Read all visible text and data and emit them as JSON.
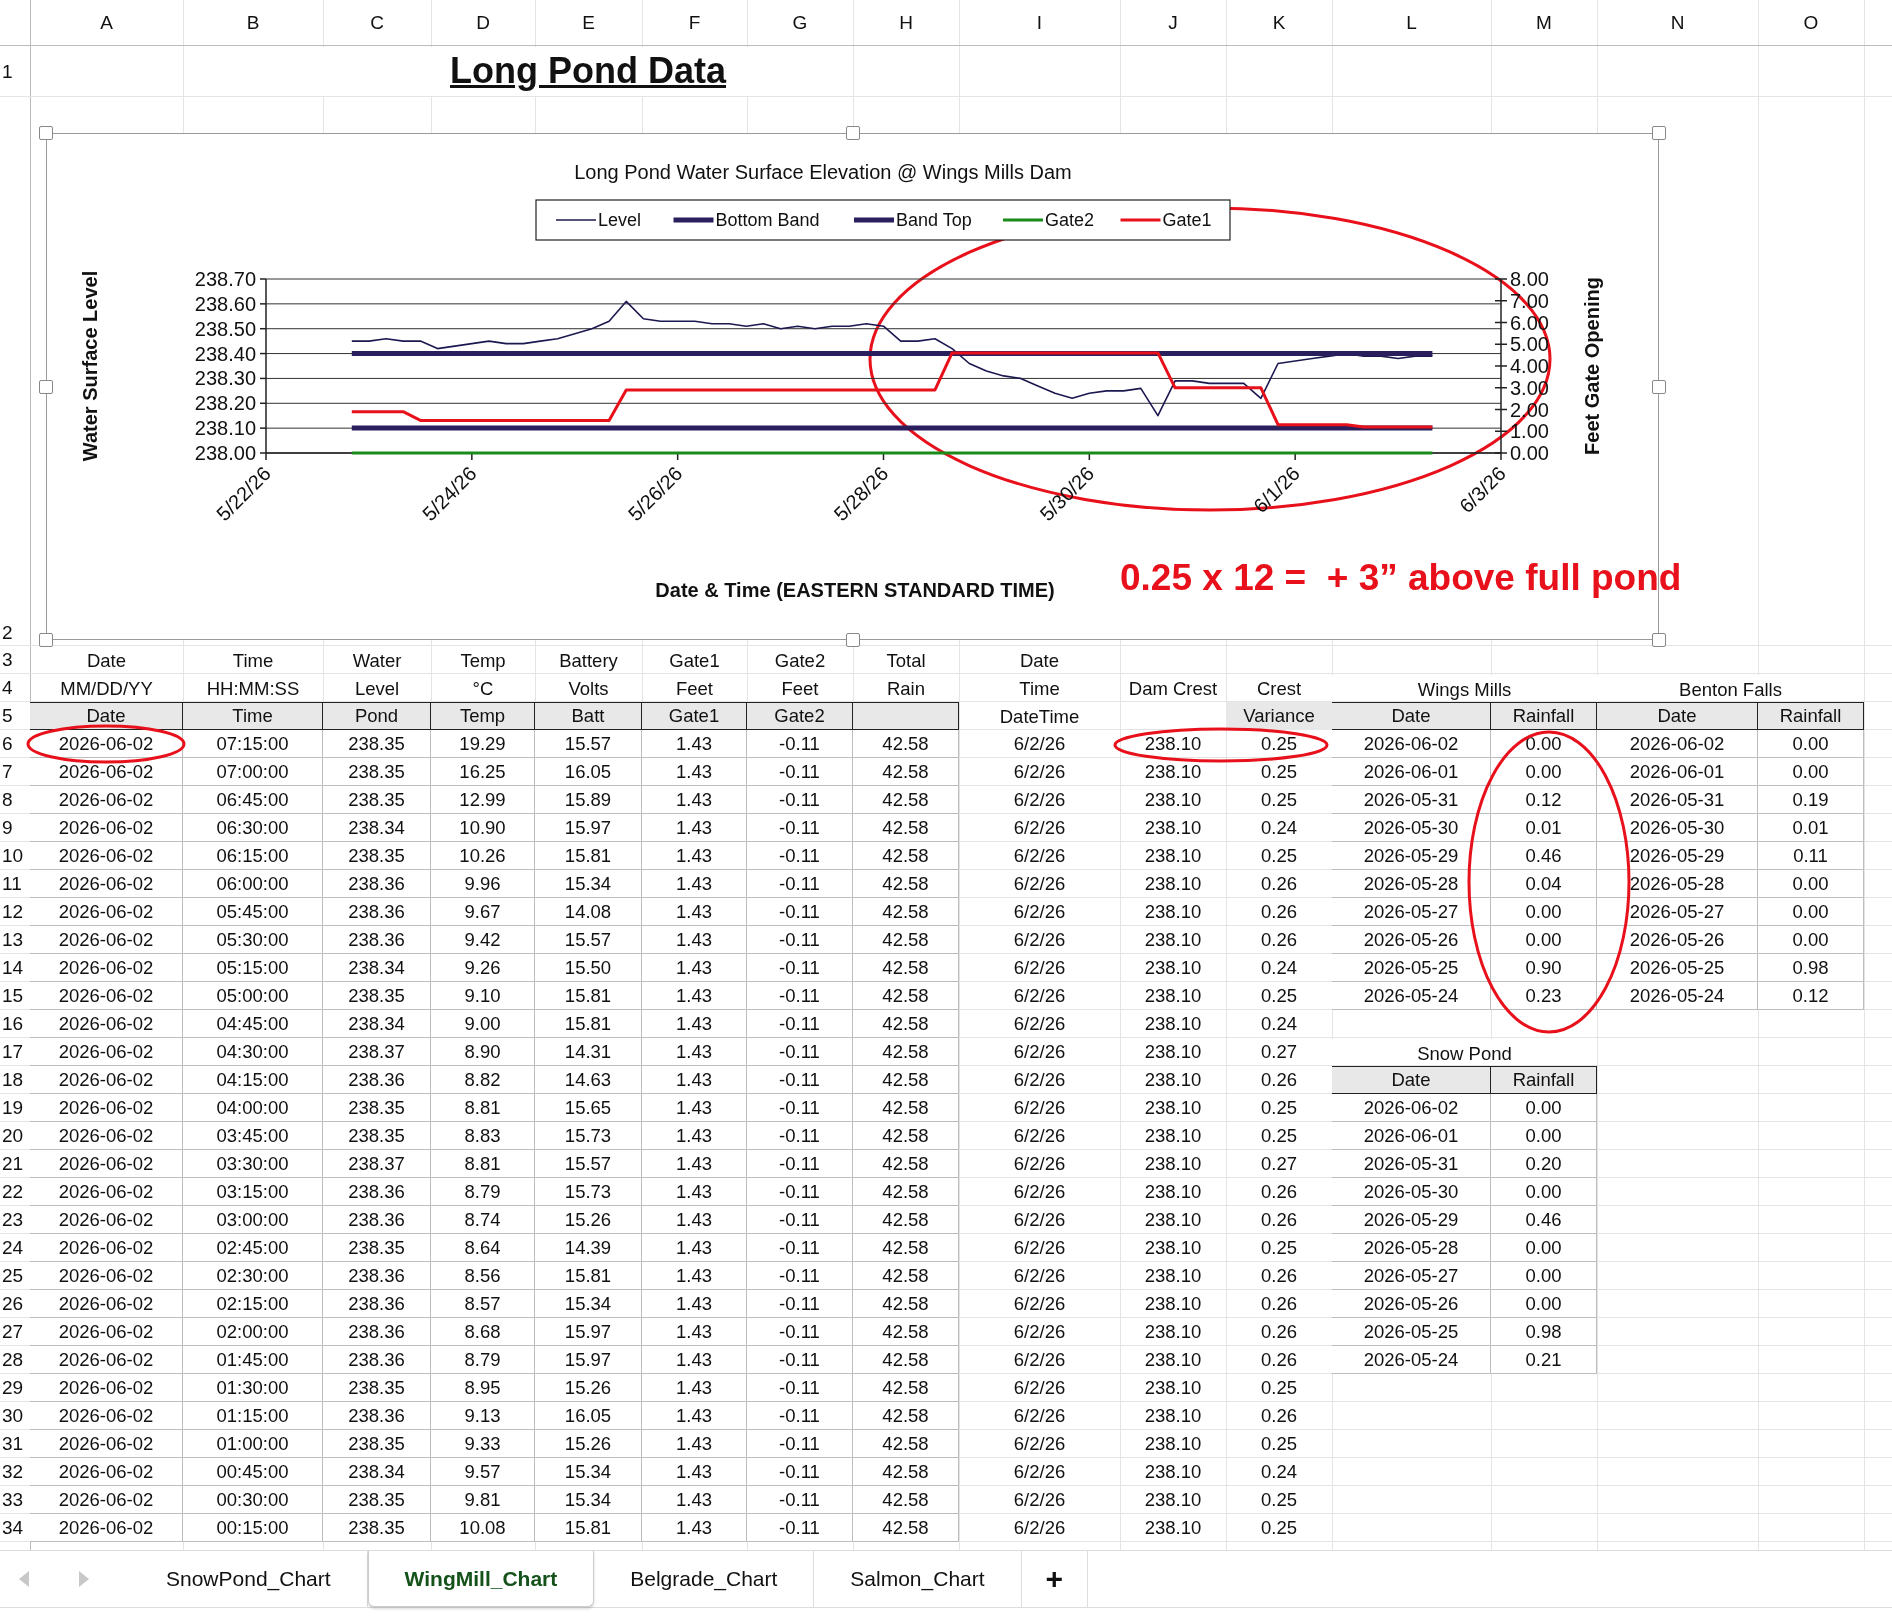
{
  "column_headers": [
    "A",
    "B",
    "C",
    "D",
    "E",
    "F",
    "G",
    "H",
    "I",
    "J",
    "K",
    "L",
    "M",
    "N",
    "O"
  ],
  "row_numbers": [
    "1",
    "2",
    "3",
    "4",
    "5",
    "6",
    "7",
    "8",
    "9",
    "10",
    "11",
    "12",
    "13",
    "14",
    "15",
    "16",
    "17",
    "18",
    "19",
    "20",
    "21",
    "22",
    "23",
    "24",
    "25",
    "26",
    "27",
    "28",
    "29",
    "30",
    "31",
    "32",
    "33",
    "34"
  ],
  "title": "Long Pond Data",
  "chart": {
    "selected": true,
    "chart_data": {
      "type": "line",
      "title": "Long Pond Water Surface Elevation @ Wings Mills Dam",
      "xlabel": "Date & Time (EASTERN STANDARD TIME)",
      "ylabel": "Water Surface Level",
      "y2label": "Feet Gate Opening",
      "categories": [
        "5/22/26",
        null,
        null,
        null,
        null,
        null,
        null,
        null,
        null,
        null,
        null,
        null,
        "5/24/26",
        null,
        null,
        null,
        null,
        null,
        null,
        null,
        null,
        null,
        null,
        null,
        "5/26/26",
        null,
        null,
        null,
        null,
        null,
        null,
        null,
        null,
        null,
        null,
        null,
        "5/28/26",
        null,
        null,
        null,
        null,
        null,
        null,
        null,
        null,
        null,
        null,
        null,
        "5/30/26",
        null,
        null,
        null,
        null,
        null,
        null,
        null,
        null,
        null,
        null,
        null,
        "6/1/26",
        null,
        null,
        null,
        null,
        null,
        null,
        null,
        null,
        null,
        null,
        null,
        "6/3/26"
      ],
      "grid": true,
      "legend": "top",
      "ylim": [
        238.0,
        238.7
      ],
      "y2lim": [
        0,
        8
      ],
      "yticks": [
        {
          "value": 238.0,
          "label": "238.00"
        },
        {
          "value": 238.1,
          "label": "238.10"
        },
        {
          "value": 238.2,
          "label": "238.20"
        },
        {
          "value": 238.3,
          "label": "238.30"
        },
        {
          "value": 238.4,
          "label": "238.40"
        },
        {
          "value": 238.5,
          "label": "238.50"
        },
        {
          "value": 238.6,
          "label": "238.60"
        },
        {
          "value": 238.7,
          "label": "238.70"
        }
      ],
      "y2ticks": [
        {
          "value": 0,
          "label": "0.00"
        },
        {
          "value": 1,
          "label": "1.00"
        },
        {
          "value": 2,
          "label": "2.00"
        },
        {
          "value": 3,
          "label": "3.00"
        },
        {
          "value": 4,
          "label": "4.00"
        },
        {
          "value": 5,
          "label": "5.00"
        },
        {
          "value": 6,
          "label": "6.00"
        },
        {
          "value": 7,
          "label": "7.00"
        },
        {
          "value": 8,
          "label": "8.00"
        }
      ],
      "series": [
        {
          "name": "Level",
          "color": "#1c1850",
          "values": [
            null,
            null,
            null,
            null,
            null,
            238.45,
            238.45,
            238.46,
            238.45,
            238.45,
            238.42,
            238.43,
            238.44,
            238.45,
            238.44,
            238.44,
            238.45,
            238.46,
            238.48,
            238.5,
            238.53,
            238.61,
            238.54,
            238.53,
            238.53,
            238.53,
            238.52,
            238.52,
            238.51,
            238.52,
            238.5,
            238.51,
            238.5,
            238.51,
            238.51,
            238.52,
            238.51,
            238.45,
            238.45,
            238.46,
            238.42,
            238.36,
            238.33,
            238.31,
            238.3,
            238.27,
            238.24,
            238.22,
            238.24,
            238.25,
            238.25,
            238.26,
            238.15,
            238.29,
            238.29,
            238.28,
            238.28,
            238.28,
            238.22,
            238.36,
            238.37,
            238.38,
            238.39,
            238.4,
            238.39,
            238.39,
            238.38,
            238.39,
            238.39,
            null,
            null,
            null,
            null
          ]
        },
        {
          "name": "Bottom Band",
          "color": "#2a1f5c",
          "values": [
            null,
            null,
            null,
            null,
            null,
            238.1,
            238.1,
            238.1,
            238.1,
            238.1,
            238.1,
            238.1,
            238.1,
            238.1,
            238.1,
            238.1,
            238.1,
            238.1,
            238.1,
            238.1,
            238.1,
            238.1,
            238.1,
            238.1,
            238.1,
            238.1,
            238.1,
            238.1,
            238.1,
            238.1,
            238.1,
            238.1,
            238.1,
            238.1,
            238.1,
            238.1,
            238.1,
            238.1,
            238.1,
            238.1,
            238.1,
            238.1,
            238.1,
            238.1,
            238.1,
            238.1,
            238.1,
            238.1,
            238.1,
            238.1,
            238.1,
            238.1,
            238.1,
            238.1,
            238.1,
            238.1,
            238.1,
            238.1,
            238.1,
            238.1,
            238.1,
            238.1,
            238.1,
            238.1,
            238.1,
            238.1,
            238.1,
            238.1,
            238.1,
            null,
            null,
            null,
            null
          ]
        },
        {
          "name": "Band Top",
          "color": "#2a1f5c",
          "values": [
            null,
            null,
            null,
            null,
            null,
            238.4,
            238.4,
            238.4,
            238.4,
            238.4,
            238.4,
            238.4,
            238.4,
            238.4,
            238.4,
            238.4,
            238.4,
            238.4,
            238.4,
            238.4,
            238.4,
            238.4,
            238.4,
            238.4,
            238.4,
            238.4,
            238.4,
            238.4,
            238.4,
            238.4,
            238.4,
            238.4,
            238.4,
            238.4,
            238.4,
            238.4,
            238.4,
            238.4,
            238.4,
            238.4,
            238.4,
            238.4,
            238.4,
            238.4,
            238.4,
            238.4,
            238.4,
            238.4,
            238.4,
            238.4,
            238.4,
            238.4,
            238.4,
            238.4,
            238.4,
            238.4,
            238.4,
            238.4,
            238.4,
            238.4,
            238.4,
            238.4,
            238.4,
            238.4,
            238.4,
            238.4,
            238.4,
            238.4,
            238.4,
            null,
            null,
            null,
            null
          ]
        },
        {
          "name": "Gate2",
          "color": "#1a8a1a",
          "axis": "y2",
          "values": [
            null,
            null,
            null,
            null,
            null,
            0,
            0,
            0,
            0,
            0,
            0,
            0,
            0,
            0,
            0,
            0,
            0,
            0,
            0,
            0,
            0,
            0,
            0,
            0,
            0,
            0,
            0,
            0,
            0,
            0,
            0,
            0,
            0,
            0,
            0,
            0,
            0,
            0,
            0,
            0,
            0,
            0,
            0,
            0,
            0,
            0,
            0,
            0,
            0,
            0,
            0,
            0,
            0,
            0,
            0,
            0,
            0,
            0,
            0,
            0,
            0,
            0,
            0,
            0,
            0,
            0,
            0,
            0,
            0,
            null,
            null,
            null,
            null
          ]
        },
        {
          "name": "Gate1",
          "color": "#e8101a",
          "axis": "y2",
          "values": [
            null,
            null,
            null,
            null,
            null,
            1.9,
            1.9,
            1.9,
            1.9,
            1.5,
            1.5,
            1.5,
            1.5,
            1.5,
            1.5,
            1.5,
            1.5,
            1.5,
            1.5,
            1.5,
            1.5,
            2.9,
            2.9,
            2.9,
            2.9,
            2.9,
            2.9,
            2.9,
            2.9,
            2.9,
            2.9,
            2.9,
            2.9,
            2.9,
            2.9,
            2.9,
            2.9,
            2.9,
            2.9,
            2.9,
            4.6,
            4.6,
            4.6,
            4.6,
            4.6,
            4.6,
            4.6,
            4.6,
            4.6,
            4.6,
            4.6,
            4.6,
            4.6,
            3.0,
            3.0,
            3.0,
            3.0,
            3.0,
            3.0,
            1.3,
            1.3,
            1.3,
            1.3,
            1.3,
            1.2,
            1.2,
            1.2,
            1.2,
            1.2,
            null,
            null,
            null,
            null
          ]
        }
      ]
    }
  },
  "note": "0.25 x 12 =  + 3” above full pond",
  "data_table": {
    "header_rows": [
      [
        "Date",
        "Time",
        "Water",
        "Temp",
        "Battery",
        "Gate1",
        "Gate2",
        "Total",
        "Date",
        null,
        null
      ],
      [
        "MM/DD/YY",
        "HH:MM:SS",
        "Level",
        "°C",
        "Volts",
        "Feet",
        "Feet",
        "Rain",
        "Time",
        "Dam Crest",
        "Crest"
      ],
      [
        "Date",
        "Time",
        "Pond",
        "Temp",
        "Batt",
        "Gate1",
        "Gate2",
        null,
        "DateTime",
        null,
        "Variance"
      ]
    ],
    "rows": [
      [
        "2026-06-02",
        "07:15:00",
        "238.35",
        "19.29",
        "15.57",
        "1.43",
        "-0.11",
        "42.58",
        "6/2/26",
        "238.10",
        "0.25"
      ],
      [
        "2026-06-02",
        "07:00:00",
        "238.35",
        "16.25",
        "16.05",
        "1.43",
        "-0.11",
        "42.58",
        "6/2/26",
        "238.10",
        "0.25"
      ],
      [
        "2026-06-02",
        "06:45:00",
        "238.35",
        "12.99",
        "15.89",
        "1.43",
        "-0.11",
        "42.58",
        "6/2/26",
        "238.10",
        "0.25"
      ],
      [
        "2026-06-02",
        "06:30:00",
        "238.34",
        "10.90",
        "15.97",
        "1.43",
        "-0.11",
        "42.58",
        "6/2/26",
        "238.10",
        "0.24"
      ],
      [
        "2026-06-02",
        "06:15:00",
        "238.35",
        "10.26",
        "15.81",
        "1.43",
        "-0.11",
        "42.58",
        "6/2/26",
        "238.10",
        "0.25"
      ],
      [
        "2026-06-02",
        "06:00:00",
        "238.36",
        "9.96",
        "15.34",
        "1.43",
        "-0.11",
        "42.58",
        "6/2/26",
        "238.10",
        "0.26"
      ],
      [
        "2026-06-02",
        "05:45:00",
        "238.36",
        "9.67",
        "14.08",
        "1.43",
        "-0.11",
        "42.58",
        "6/2/26",
        "238.10",
        "0.26"
      ],
      [
        "2026-06-02",
        "05:30:00",
        "238.36",
        "9.42",
        "15.57",
        "1.43",
        "-0.11",
        "42.58",
        "6/2/26",
        "238.10",
        "0.26"
      ],
      [
        "2026-06-02",
        "05:15:00",
        "238.34",
        "9.26",
        "15.50",
        "1.43",
        "-0.11",
        "42.58",
        "6/2/26",
        "238.10",
        "0.24"
      ],
      [
        "2026-06-02",
        "05:00:00",
        "238.35",
        "9.10",
        "15.81",
        "1.43",
        "-0.11",
        "42.58",
        "6/2/26",
        "238.10",
        "0.25"
      ],
      [
        "2026-06-02",
        "04:45:00",
        "238.34",
        "9.00",
        "15.81",
        "1.43",
        "-0.11",
        "42.58",
        "6/2/26",
        "238.10",
        "0.24"
      ],
      [
        "2026-06-02",
        "04:30:00",
        "238.37",
        "8.90",
        "14.31",
        "1.43",
        "-0.11",
        "42.58",
        "6/2/26",
        "238.10",
        "0.27"
      ],
      [
        "2026-06-02",
        "04:15:00",
        "238.36",
        "8.82",
        "14.63",
        "1.43",
        "-0.11",
        "42.58",
        "6/2/26",
        "238.10",
        "0.26"
      ],
      [
        "2026-06-02",
        "04:00:00",
        "238.35",
        "8.81",
        "15.65",
        "1.43",
        "-0.11",
        "42.58",
        "6/2/26",
        "238.10",
        "0.25"
      ],
      [
        "2026-06-02",
        "03:45:00",
        "238.35",
        "8.83",
        "15.73",
        "1.43",
        "-0.11",
        "42.58",
        "6/2/26",
        "238.10",
        "0.25"
      ],
      [
        "2026-06-02",
        "03:30:00",
        "238.37",
        "8.81",
        "15.57",
        "1.43",
        "-0.11",
        "42.58",
        "6/2/26",
        "238.10",
        "0.27"
      ],
      [
        "2026-06-02",
        "03:15:00",
        "238.36",
        "8.79",
        "15.73",
        "1.43",
        "-0.11",
        "42.58",
        "6/2/26",
        "238.10",
        "0.26"
      ],
      [
        "2026-06-02",
        "03:00:00",
        "238.36",
        "8.74",
        "15.26",
        "1.43",
        "-0.11",
        "42.58",
        "6/2/26",
        "238.10",
        "0.26"
      ],
      [
        "2026-06-02",
        "02:45:00",
        "238.35",
        "8.64",
        "14.39",
        "1.43",
        "-0.11",
        "42.58",
        "6/2/26",
        "238.10",
        "0.25"
      ],
      [
        "2026-06-02",
        "02:30:00",
        "238.36",
        "8.56",
        "15.81",
        "1.43",
        "-0.11",
        "42.58",
        "6/2/26",
        "238.10",
        "0.26"
      ],
      [
        "2026-06-02",
        "02:15:00",
        "238.36",
        "8.57",
        "15.34",
        "1.43",
        "-0.11",
        "42.58",
        "6/2/26",
        "238.10",
        "0.26"
      ],
      [
        "2026-06-02",
        "02:00:00",
        "238.36",
        "8.68",
        "15.97",
        "1.43",
        "-0.11",
        "42.58",
        "6/2/26",
        "238.10",
        "0.26"
      ],
      [
        "2026-06-02",
        "01:45:00",
        "238.36",
        "8.79",
        "15.97",
        "1.43",
        "-0.11",
        "42.58",
        "6/2/26",
        "238.10",
        "0.26"
      ],
      [
        "2026-06-02",
        "01:30:00",
        "238.35",
        "8.95",
        "15.26",
        "1.43",
        "-0.11",
        "42.58",
        "6/2/26",
        "238.10",
        "0.25"
      ],
      [
        "2026-06-02",
        "01:15:00",
        "238.36",
        "9.13",
        "16.05",
        "1.43",
        "-0.11",
        "42.58",
        "6/2/26",
        "238.10",
        "0.26"
      ],
      [
        "2026-06-02",
        "01:00:00",
        "238.35",
        "9.33",
        "15.26",
        "1.43",
        "-0.11",
        "42.58",
        "6/2/26",
        "238.10",
        "0.25"
      ],
      [
        "2026-06-02",
        "00:45:00",
        "238.34",
        "9.57",
        "15.34",
        "1.43",
        "-0.11",
        "42.58",
        "6/2/26",
        "238.10",
        "0.24"
      ],
      [
        "2026-06-02",
        "00:30:00",
        "238.35",
        "9.81",
        "15.34",
        "1.43",
        "-0.11",
        "42.58",
        "6/2/26",
        "238.10",
        "0.25"
      ],
      [
        "2026-06-02",
        "00:15:00",
        "238.35",
        "10.08",
        "15.81",
        "1.43",
        "-0.11",
        "42.58",
        "6/2/26",
        "238.10",
        "0.25"
      ]
    ]
  },
  "side_tables": [
    {
      "title": "Wings Mills",
      "columns": [
        "Date",
        "Rainfall"
      ],
      "rows": [
        [
          "2026-06-02",
          "0.00"
        ],
        [
          "2026-06-01",
          "0.00"
        ],
        [
          "2026-05-31",
          "0.12"
        ],
        [
          "2026-05-30",
          "0.01"
        ],
        [
          "2026-05-29",
          "0.46"
        ],
        [
          "2026-05-28",
          "0.04"
        ],
        [
          "2026-05-27",
          "0.00"
        ],
        [
          "2026-05-26",
          "0.00"
        ],
        [
          "2026-05-25",
          "0.90"
        ],
        [
          "2026-05-24",
          "0.23"
        ]
      ]
    },
    {
      "title": "Benton Falls",
      "columns": [
        "Date",
        "Rainfall"
      ],
      "rows": [
        [
          "2026-06-02",
          "0.00"
        ],
        [
          "2026-06-01",
          "0.00"
        ],
        [
          "2026-05-31",
          "0.19"
        ],
        [
          "2026-05-30",
          "0.01"
        ],
        [
          "2026-05-29",
          "0.11"
        ],
        [
          "2026-05-28",
          "0.00"
        ],
        [
          "2026-05-27",
          "0.00"
        ],
        [
          "2026-05-26",
          "0.00"
        ],
        [
          "2026-05-25",
          "0.98"
        ],
        [
          "2026-05-24",
          "0.12"
        ]
      ]
    },
    {
      "title": "Snow Pond",
      "columns": [
        "Date",
        "Rainfall"
      ],
      "rows": [
        [
          "2026-06-02",
          "0.00"
        ],
        [
          "2026-06-01",
          "0.00"
        ],
        [
          "2026-05-31",
          "0.20"
        ],
        [
          "2026-05-30",
          "0.00"
        ],
        [
          "2026-05-29",
          "0.46"
        ],
        [
          "2026-05-28",
          "0.00"
        ],
        [
          "2026-05-27",
          "0.00"
        ],
        [
          "2026-05-26",
          "0.00"
        ],
        [
          "2026-05-25",
          "0.98"
        ],
        [
          "2026-05-24",
          "0.21"
        ]
      ]
    }
  ],
  "sheet_tabs": [
    {
      "label": "SnowPond_Chart",
      "selected": false
    },
    {
      "label": "WingMill_Chart",
      "selected": true
    },
    {
      "label": "Belgrade_Chart",
      "selected": false
    },
    {
      "label": "Salmon_Chart",
      "selected": false
    }
  ],
  "add_sheet_button": "+"
}
